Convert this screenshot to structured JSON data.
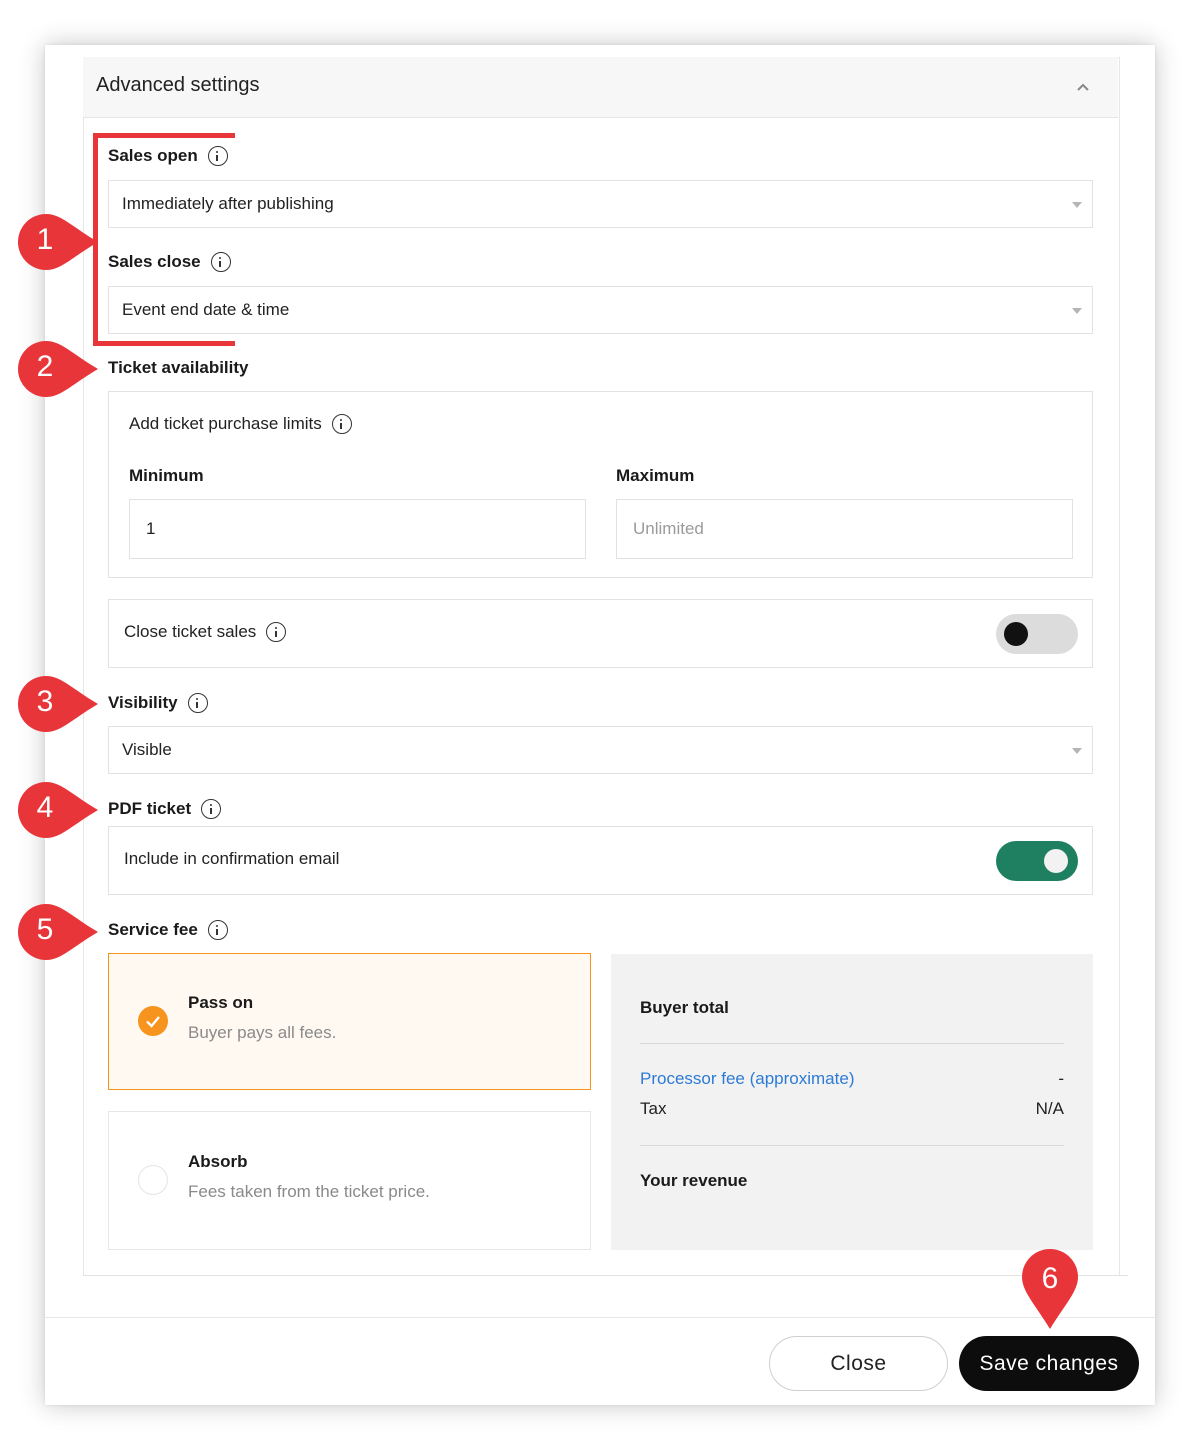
{
  "panel": {
    "title": "Advanced settings"
  },
  "sales_open": {
    "label": "Sales open",
    "value": "Immediately after publishing"
  },
  "sales_close": {
    "label": "Sales close",
    "value": "Event end date & time"
  },
  "ticket_availability": {
    "label": "Ticket availability",
    "limits_label": "Add ticket purchase limits",
    "minimum_label": "Minimum",
    "minimum_value": "1",
    "maximum_label": "Maximum",
    "maximum_placeholder": "Unlimited"
  },
  "close_ticket_sales": {
    "label": "Close ticket sales",
    "enabled": false
  },
  "visibility": {
    "label": "Visibility",
    "value": "Visible"
  },
  "pdf_ticket": {
    "label": "PDF ticket",
    "option_label": "Include in confirmation email",
    "enabled": true
  },
  "service_fee": {
    "label": "Service fee",
    "options": [
      {
        "title": "Pass on",
        "subtitle": "Buyer pays all fees.",
        "selected": true
      },
      {
        "title": "Absorb",
        "subtitle": "Fees taken from the ticket price.",
        "selected": false
      }
    ],
    "summary": {
      "buyer_total_label": "Buyer total",
      "processor_fee_label": "Processor fee (approximate)",
      "processor_fee_value": "-",
      "tax_label": "Tax",
      "tax_value": "N/A",
      "revenue_label": "Your revenue"
    }
  },
  "footer": {
    "close_label": "Close",
    "save_label": "Save changes"
  },
  "annotations": {
    "markers": [
      "1",
      "2",
      "3",
      "4",
      "5",
      "6"
    ]
  },
  "colors": {
    "accent_orange": "#f7941d",
    "toggle_on": "#1e8061",
    "link_blue": "#2d7bd6",
    "marker_red": "#e8353a",
    "save_bg": "#0d0d0d"
  }
}
